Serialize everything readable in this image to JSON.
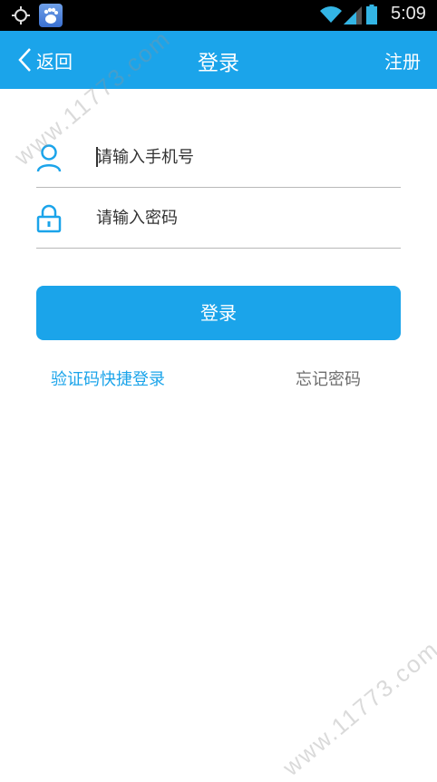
{
  "status_bar": {
    "time": "5:09",
    "icons": [
      "gps-icon",
      "baidu-app-icon",
      "wifi-icon",
      "signal-icon",
      "battery-icon"
    ]
  },
  "nav": {
    "back_label": "返回",
    "title": "登录",
    "register_label": "注册",
    "background_color": "#1ba4ea"
  },
  "form": {
    "phone_placeholder": "请输入手机号",
    "password_placeholder": "请输入密码",
    "login_label": "登录"
  },
  "links": {
    "sms_login": "验证码快捷登录",
    "forgot_password": "忘记密码"
  },
  "watermark": {
    "text": "www.11773.com"
  }
}
